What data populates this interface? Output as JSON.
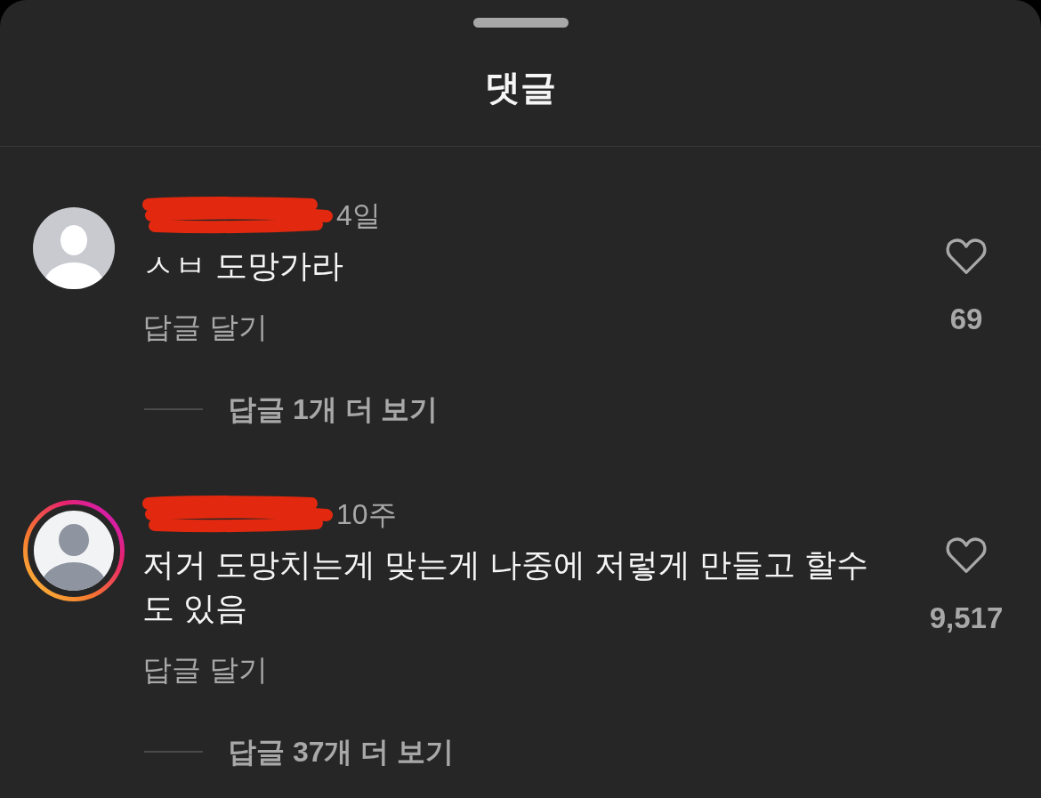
{
  "sheet": {
    "title": "댓글"
  },
  "comments": [
    {
      "redacted": true,
      "story_ring": false,
      "time": "4일",
      "text": "ㅅㅂ 도망가라",
      "reply_label": "답글 달기",
      "more_replies": "답글 1개 더 보기",
      "likes": "69"
    },
    {
      "redacted": true,
      "story_ring": true,
      "time": "10주",
      "text": "저거 도망치는게 맞는게 나중에 저렇게 만들고 할수도 있음",
      "reply_label": "답글 달기",
      "more_replies": "답글 37개 더 보기",
      "likes": "9,517"
    }
  ]
}
